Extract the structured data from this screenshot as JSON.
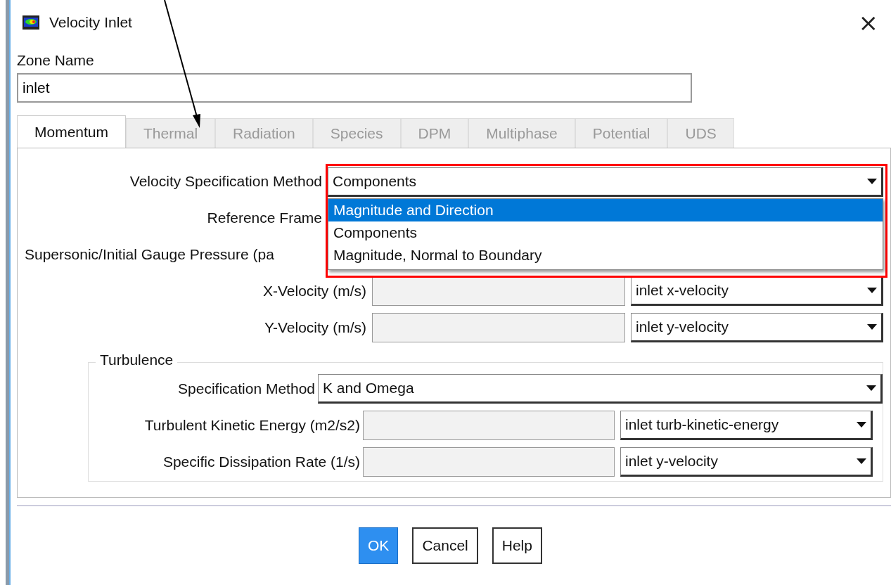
{
  "window": {
    "title": "Velocity Inlet",
    "close": "×"
  },
  "zone_name": {
    "label": "Zone Name",
    "value": "inlet"
  },
  "tabs": [
    {
      "label": "Momentum",
      "selected": true,
      "disabled": false
    },
    {
      "label": "Thermal",
      "selected": false,
      "disabled": true
    },
    {
      "label": "Radiation",
      "selected": false,
      "disabled": true
    },
    {
      "label": "Species",
      "selected": false,
      "disabled": true
    },
    {
      "label": "DPM",
      "selected": false,
      "disabled": true
    },
    {
      "label": "Multiphase",
      "selected": false,
      "disabled": true
    },
    {
      "label": "Potential",
      "selected": false,
      "disabled": true
    },
    {
      "label": "UDS",
      "selected": false,
      "disabled": true
    }
  ],
  "momentum": {
    "rows": [
      {
        "kind": "combo",
        "label": "Velocity Specification Method",
        "value": "Components",
        "menu": [
          {
            "label": "Magnitude and Direction",
            "highlighted": true
          },
          {
            "label": "Components",
            "highlighted": false
          },
          {
            "label": "Magnitude, Normal to Boundary",
            "highlighted": false
          }
        ]
      },
      {
        "kind": "covered",
        "label": "Reference Frame"
      },
      {
        "kind": "cut",
        "label": "Supersonic/Initial Gauge Pressure (pa"
      },
      {
        "kind": "pair",
        "label": "X-Velocity (m/s)",
        "profile": "inlet x-velocity"
      },
      {
        "kind": "pair",
        "label": "Y-Velocity (m/s)",
        "profile": "inlet y-velocity"
      }
    ]
  },
  "turbulence": {
    "title": "Turbulence",
    "rows": [
      {
        "kind": "combo",
        "label": "Specification Method",
        "value": "K and Omega"
      },
      {
        "kind": "pair",
        "label": "Turbulent Kinetic Energy (m2/s2)",
        "profile": "inlet turb-kinetic-energy"
      },
      {
        "kind": "pair",
        "label": "Specific Dissipation Rate (1/s)",
        "profile": "inlet y-velocity"
      }
    ]
  },
  "buttons": [
    {
      "label": "OK",
      "default": true
    },
    {
      "label": "Cancel",
      "default": false
    },
    {
      "label": "Help",
      "default": false
    }
  ]
}
